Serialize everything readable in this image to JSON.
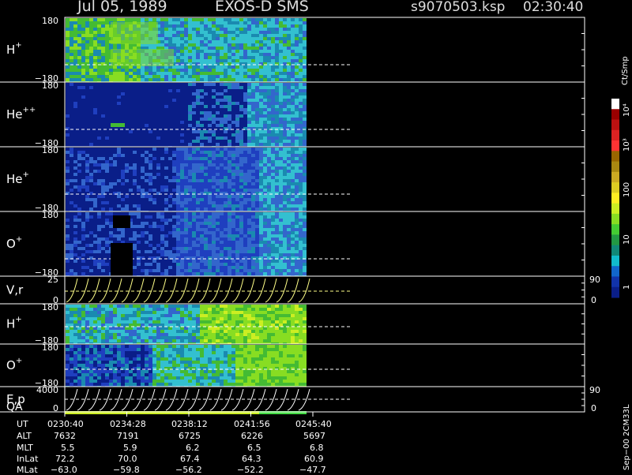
{
  "header": {
    "date": "Jul 05, 1989",
    "instrument": "EXOS-D SMS",
    "file": "s9070503.ksp",
    "time": "02:30:40"
  },
  "colors": {
    "background": "#000000",
    "axis": "#ffffff",
    "dashed_line": "#ffffff",
    "trace": "#ffff88"
  },
  "chart_data": {
    "type": "heatmap",
    "title": "",
    "panels": [
      {
        "name": "H+",
        "label": "H",
        "sup": "+",
        "ymax": "180",
        "ymin": "−180",
        "dominant": "mixed-green"
      },
      {
        "name": "He++",
        "label": "He",
        "sup": "++",
        "ymax": "180",
        "ymin": "−180",
        "dominant": "dark-blue"
      },
      {
        "name": "He+",
        "label": "He",
        "sup": "+",
        "ymax": "180",
        "ymin": "−180",
        "dominant": "blue"
      },
      {
        "name": "O+",
        "label": "O",
        "sup": "+",
        "ymax": "180",
        "ymin": "−180",
        "dominant": "blue"
      },
      {
        "name": "V,r",
        "label": "V,r",
        "sup": "",
        "ymax": "25",
        "ymin": "0",
        "right_ticks": [
          "90",
          "0"
        ],
        "dominant": "traces"
      },
      {
        "name": "H+ (2)",
        "label": "H",
        "sup": "+",
        "ymax": "180",
        "ymin": "−180",
        "dominant": "cyan-green"
      },
      {
        "name": "O+ (2)",
        "label": "O",
        "sup": "+",
        "ymax": "180",
        "ymin": "−180",
        "dominant": "blue-green"
      },
      {
        "name": "E,p QA",
        "label": "E,p",
        "label2": "QA",
        "sup": "",
        "ymax": "4000",
        "ymin": "0",
        "right_ticks": [
          "90",
          "0"
        ],
        "dominant": "traces"
      }
    ],
    "colorbar": {
      "unit_label": "Ct/Smp",
      "scale": "log",
      "range": [
        1,
        10000
      ],
      "tick_labels": [
        "10⁴",
        "10³",
        "100",
        "10",
        "1"
      ]
    },
    "side_note": "Sep−00 2CM33L",
    "time_axis": {
      "rows": [
        {
          "name": "UT",
          "values": [
            "0230:40",
            "0234:28",
            "0238:12",
            "0241:56",
            "0245:40"
          ]
        },
        {
          "name": "ALT",
          "values": [
            "7632",
            "7191",
            "6725",
            "6226",
            "5697"
          ]
        },
        {
          "name": "MLT",
          "values": [
            "5.5",
            "5.9",
            "6.2",
            "6.5",
            "6.8"
          ]
        },
        {
          "name": "InLat",
          "values": [
            "72.2",
            "70.0",
            "67.4",
            "64.3",
            "60.9"
          ]
        },
        {
          "name": "MLat",
          "values": [
            "−63.0",
            "−59.8",
            "−56.2",
            "−52.2",
            "−47.7"
          ]
        }
      ]
    },
    "data_coverage_fraction": 0.46
  }
}
